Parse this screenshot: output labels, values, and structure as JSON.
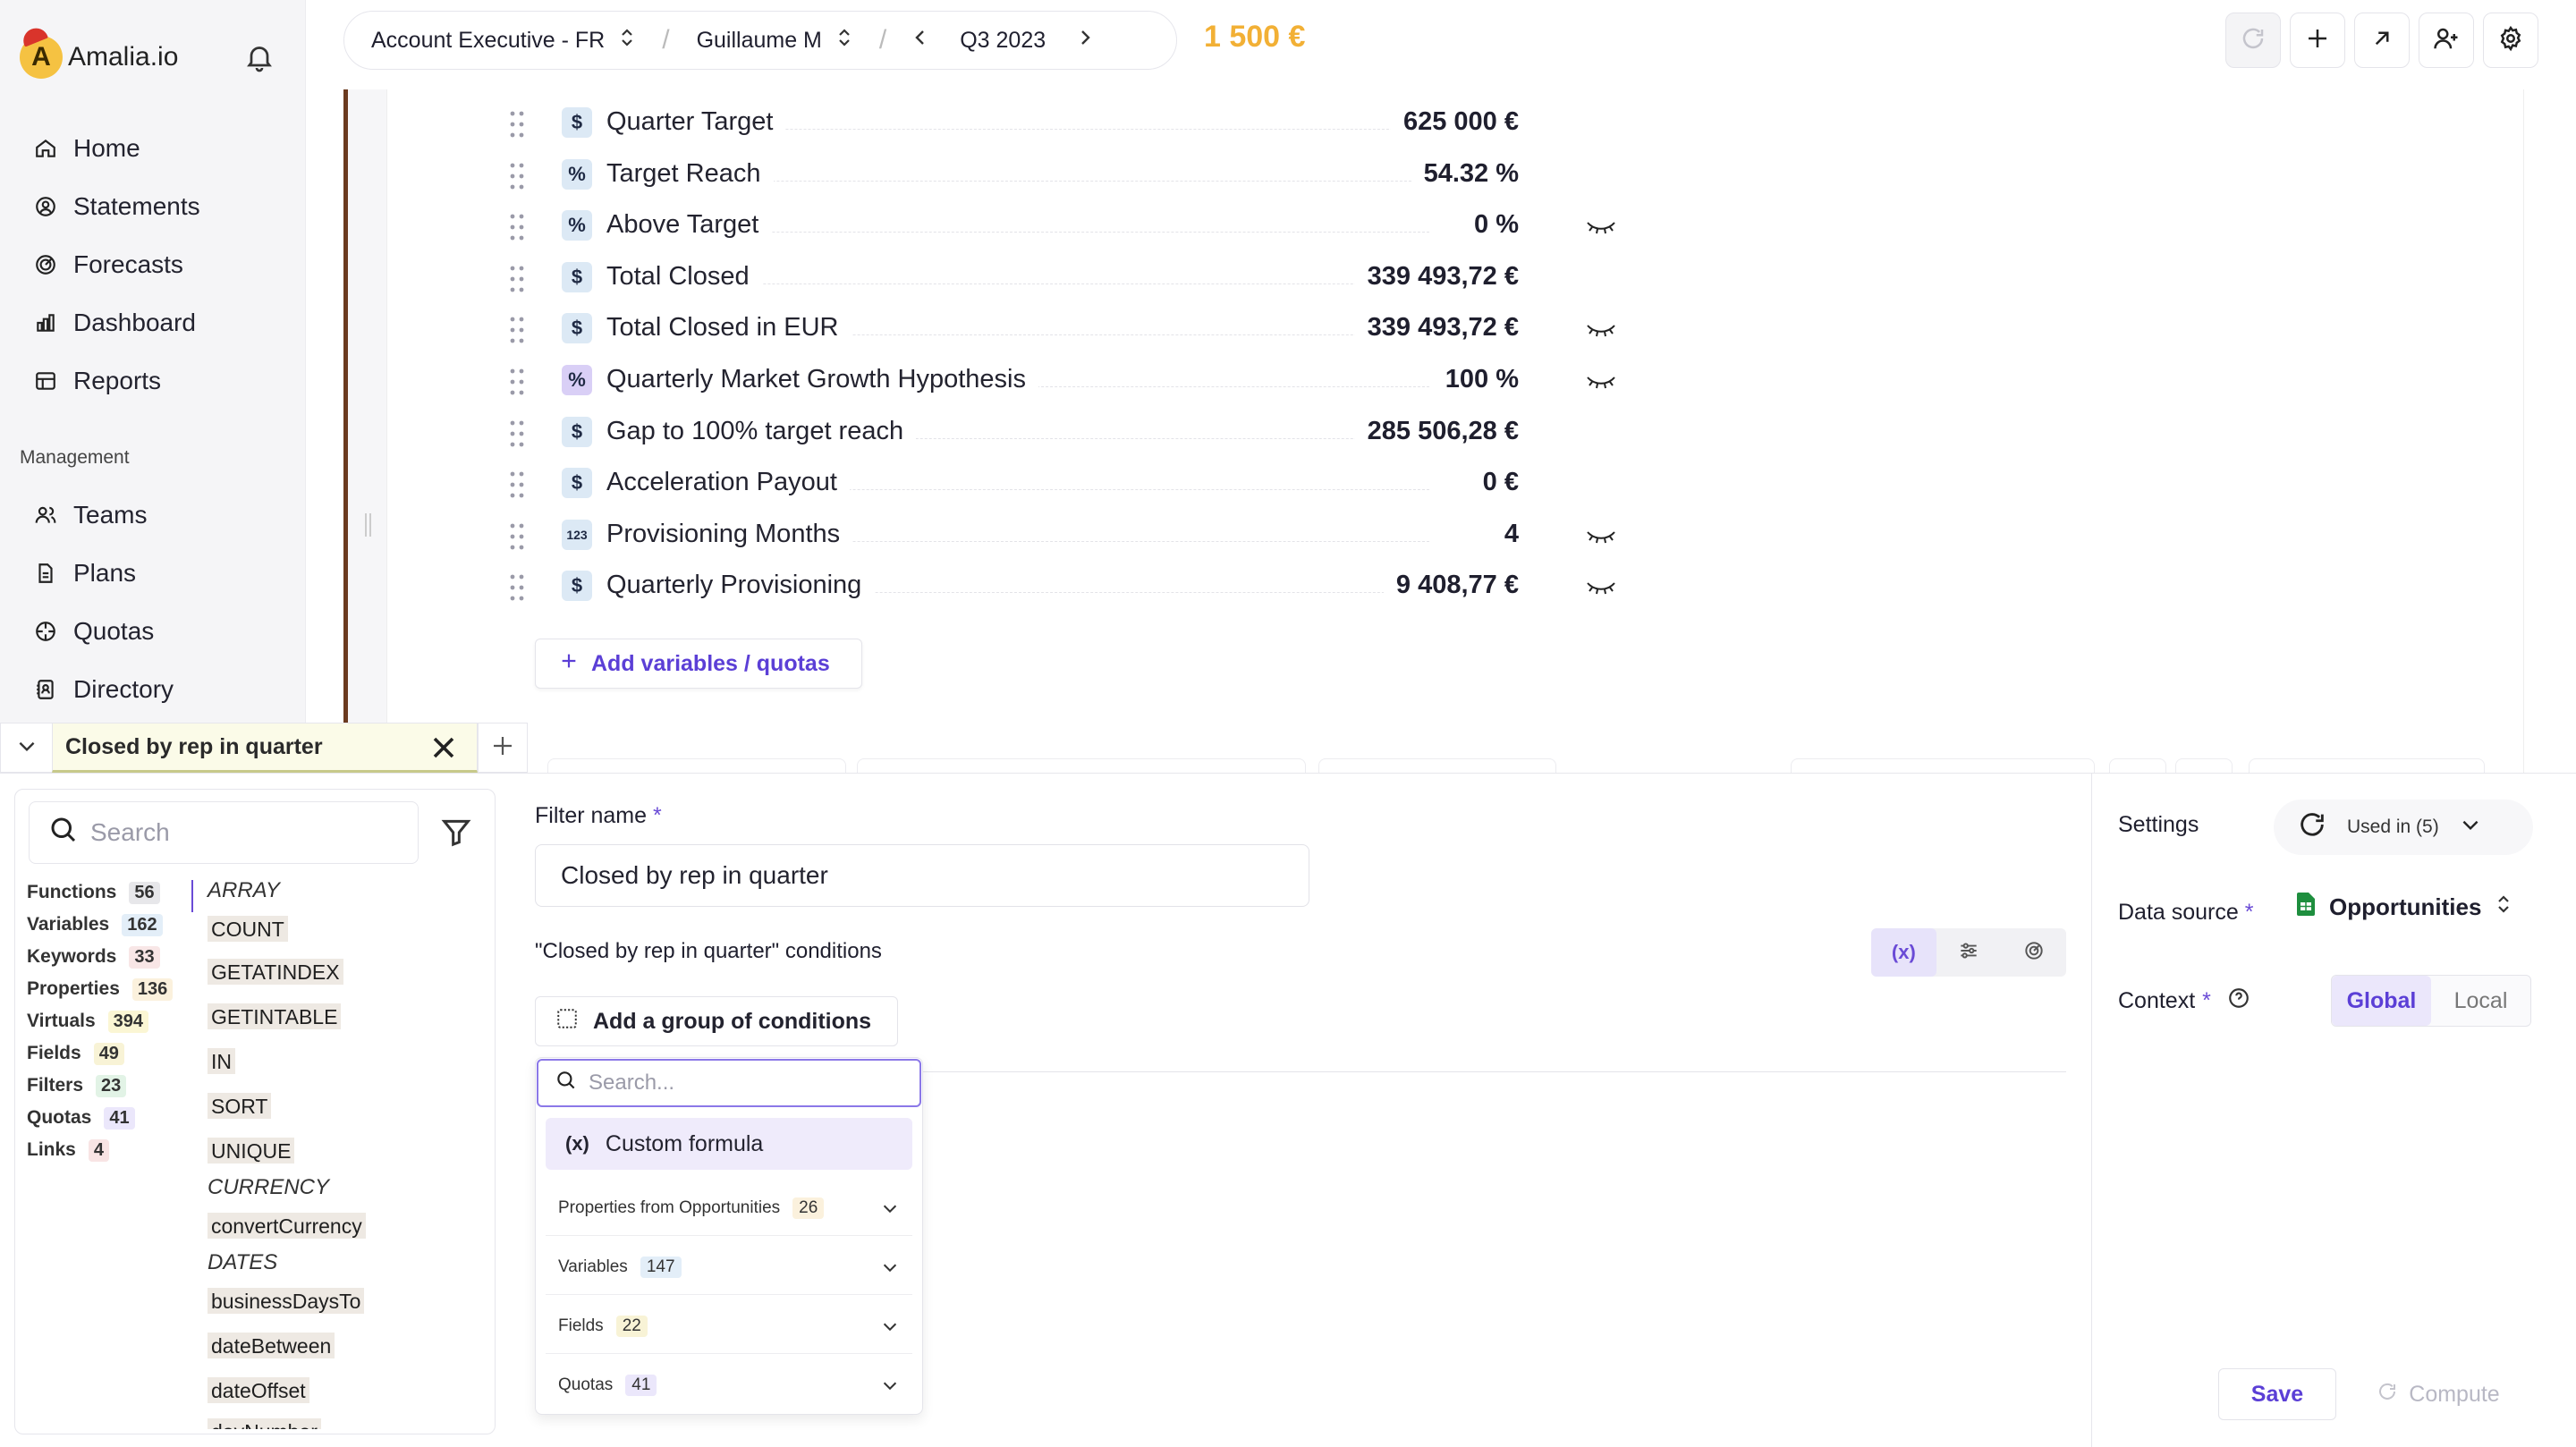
{
  "app": {
    "name": "Amalia.io",
    "logo_letter": "A"
  },
  "sidebar": {
    "items": [
      {
        "label": "Home",
        "icon": "home-icon"
      },
      {
        "label": "Statements",
        "icon": "user-circle-icon"
      },
      {
        "label": "Forecasts",
        "icon": "forecast-icon"
      },
      {
        "label": "Dashboard",
        "icon": "bar-chart-icon"
      },
      {
        "label": "Reports",
        "icon": "table-icon"
      }
    ],
    "section_label": "Management",
    "management_items": [
      {
        "label": "Teams",
        "icon": "users-icon"
      },
      {
        "label": "Plans",
        "icon": "document-icon"
      },
      {
        "label": "Quotas",
        "icon": "target-icon"
      },
      {
        "label": "Directory",
        "icon": "contacts-icon"
      }
    ]
  },
  "topbar": {
    "plan": "Account Executive - FR",
    "user": "Guillaume M",
    "period": "Q3 2023",
    "amount": "1 500 €",
    "amount_color": "#f2b035"
  },
  "variables": [
    {
      "label": "Quarter Target",
      "value": "625 000 €",
      "type": "$",
      "hidden": false
    },
    {
      "label": "Target Reach",
      "value": "54.32 %",
      "type": "%",
      "hidden": false
    },
    {
      "label": "Above Target",
      "value": "0 %",
      "type": "%",
      "hidden": true
    },
    {
      "label": "Total Closed",
      "value": "339 493,72 €",
      "type": "$",
      "hidden": false
    },
    {
      "label": "Total Closed in EUR",
      "value": "339 493,72 €",
      "type": "$",
      "hidden": true
    },
    {
      "label": "Quarterly Market Growth Hypothesis",
      "value": "100 %",
      "type": "%q",
      "hidden": true
    },
    {
      "label": "Gap to 100% target reach",
      "value": "285 506,28 €",
      "type": "$",
      "hidden": false
    },
    {
      "label": "Acceleration Payout",
      "value": "0 €",
      "type": "$",
      "hidden": false
    },
    {
      "label": "Provisioning Months",
      "value": "4",
      "type": "123",
      "hidden": true
    },
    {
      "label": "Quarterly Provisioning",
      "value": "9 408,77 €",
      "type": "$",
      "hidden": true
    }
  ],
  "add_variables_label": "Add variables / quotas",
  "tab": {
    "title": "Closed by rep in quarter"
  },
  "library": {
    "search_placeholder": "Search",
    "categories": [
      {
        "label": "Functions",
        "count": "56",
        "color": "#e7e7ea"
      },
      {
        "label": "Variables",
        "count": "162",
        "color": "#e3eef8"
      },
      {
        "label": "Keywords",
        "count": "33",
        "color": "#f8e6e6"
      },
      {
        "label": "Properties",
        "count": "136",
        "color": "#fbf1dd"
      },
      {
        "label": "Virtuals",
        "count": "394",
        "color": "#fbf6d4"
      },
      {
        "label": "Fields",
        "count": "49",
        "color": "#f8f3d6"
      },
      {
        "label": "Filters",
        "count": "23",
        "color": "#e2f3e6"
      },
      {
        "label": "Quotas",
        "count": "41",
        "color": "#ebe7fb"
      },
      {
        "label": "Links",
        "count": "4",
        "color": "#f8e4e4"
      }
    ],
    "entries": [
      {
        "text": "ARRAY",
        "kind": "cat"
      },
      {
        "text": "COUNT",
        "kind": "fn"
      },
      {
        "text": "GETATINDEX",
        "kind": "fn"
      },
      {
        "text": "GETINTABLE",
        "kind": "fn"
      },
      {
        "text": "IN",
        "kind": "fn"
      },
      {
        "text": "SORT",
        "kind": "fn"
      },
      {
        "text": "UNIQUE",
        "kind": "fn"
      },
      {
        "text": "CURRENCY",
        "kind": "cat"
      },
      {
        "text": "convertCurrency",
        "kind": "fn"
      },
      {
        "text": "DATES",
        "kind": "cat"
      },
      {
        "text": "businessDaysTo",
        "kind": "fn"
      },
      {
        "text": "dateBetween",
        "kind": "fn"
      },
      {
        "text": "dateOffset",
        "kind": "fn"
      },
      {
        "text": "dayNumber",
        "kind": "fn"
      }
    ]
  },
  "filter": {
    "name_label": "Filter name",
    "required_mark": "*",
    "name_value": "Closed by rep in quarter",
    "conditions_label": "\"Closed by rep in quarter\" conditions",
    "add_group_label": "Add a group of conditions"
  },
  "dropdown": {
    "search_placeholder": "Search...",
    "custom_label": "Custom formula",
    "custom_icon_text": "(x)",
    "items": [
      {
        "label": "Properties from Opportunities",
        "count": "26",
        "color": "#fbf1dd"
      },
      {
        "label": "Variables",
        "count": "147",
        "color": "#e3eef8"
      },
      {
        "label": "Fields",
        "count": "22",
        "color": "#f8f3d6"
      },
      {
        "label": "Quotas",
        "count": "41",
        "color": "#ebe7fb"
      }
    ]
  },
  "settings": {
    "label": "Settings",
    "used_in": "Used in (5)",
    "data_source_label": "Data source",
    "data_source_value": "Opportunities",
    "context_label": "Context",
    "context_options": [
      "Global",
      "Local"
    ],
    "context_selected": "Global"
  },
  "actions": {
    "save": "Save",
    "compute": "Compute"
  }
}
